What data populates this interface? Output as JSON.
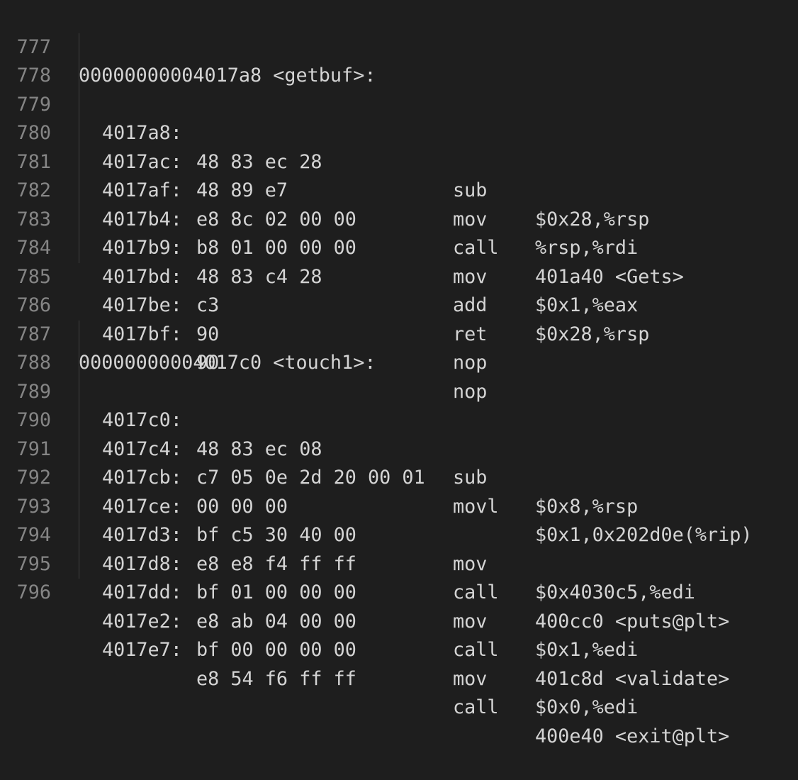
{
  "editor": {
    "lines": [
      {
        "num": "777",
        "kind": "header",
        "text": "00000000004017a8 <getbuf>:"
      },
      {
        "num": "778",
        "kind": "instr",
        "addr": "4017a8:",
        "bytes": "48 83 ec 28",
        "mnemonic": "sub",
        "operands": "$0x28,%rsp"
      },
      {
        "num": "779",
        "kind": "instr",
        "addr": "4017ac:",
        "bytes": "48 89 e7",
        "mnemonic": "mov",
        "operands": "%rsp,%rdi"
      },
      {
        "num": "780",
        "kind": "instr",
        "addr": "4017af:",
        "bytes": "e8 8c 02 00 00",
        "mnemonic": "call",
        "operands": "401a40 <Gets>"
      },
      {
        "num": "781",
        "kind": "instr",
        "addr": "4017b4:",
        "bytes": "b8 01 00 00 00",
        "mnemonic": "mov",
        "operands": "$0x1,%eax"
      },
      {
        "num": "782",
        "kind": "instr",
        "addr": "4017b9:",
        "bytes": "48 83 c4 28",
        "mnemonic": "add",
        "operands": "$0x28,%rsp"
      },
      {
        "num": "783",
        "kind": "instr",
        "addr": "4017bd:",
        "bytes": "c3",
        "mnemonic": "ret",
        "operands": ""
      },
      {
        "num": "784",
        "kind": "instr",
        "addr": "4017be:",
        "bytes": "90",
        "mnemonic": "nop",
        "operands": ""
      },
      {
        "num": "785",
        "kind": "instr",
        "addr": "4017bf:",
        "bytes": "90",
        "mnemonic": "nop",
        "operands": ""
      },
      {
        "num": "786",
        "kind": "blank"
      },
      {
        "num": "787",
        "kind": "header",
        "text": "00000000004017c0 <touch1>:"
      },
      {
        "num": "788",
        "kind": "instr",
        "addr": "4017c0:",
        "bytes": "48 83 ec 08",
        "mnemonic": "sub",
        "operands": "$0x8,%rsp"
      },
      {
        "num": "789",
        "kind": "instr",
        "addr": "4017c4:",
        "bytes": "c7 05 0e 2d 20 00 01",
        "mnemonic": "movl",
        "operands": "$0x1,0x202d0e(%rip)"
      },
      {
        "num": "790",
        "kind": "instr",
        "addr": "4017cb:",
        "bytes": "00 00 00",
        "mnemonic": "",
        "operands": ""
      },
      {
        "num": "791",
        "kind": "instr",
        "addr": "4017ce:",
        "bytes": "bf c5 30 40 00",
        "mnemonic": "mov",
        "operands": "$0x4030c5,%edi"
      },
      {
        "num": "792",
        "kind": "instr",
        "addr": "4017d3:",
        "bytes": "e8 e8 f4 ff ff",
        "mnemonic": "call",
        "operands": "400cc0 <puts@plt>"
      },
      {
        "num": "793",
        "kind": "instr",
        "addr": "4017d8:",
        "bytes": "bf 01 00 00 00",
        "mnemonic": "mov",
        "operands": "$0x1,%edi"
      },
      {
        "num": "794",
        "kind": "instr",
        "addr": "4017dd:",
        "bytes": "e8 ab 04 00 00",
        "mnemonic": "call",
        "operands": "401c8d <validate>"
      },
      {
        "num": "795",
        "kind": "instr",
        "addr": "4017e2:",
        "bytes": "bf 00 00 00 00",
        "mnemonic": "mov",
        "operands": "$0x0,%edi"
      },
      {
        "num": "796",
        "kind": "instr",
        "addr": "4017e7:",
        "bytes": "e8 54 f6 ff ff",
        "mnemonic": "call",
        "operands": "400e40 <exit@plt>"
      }
    ]
  }
}
